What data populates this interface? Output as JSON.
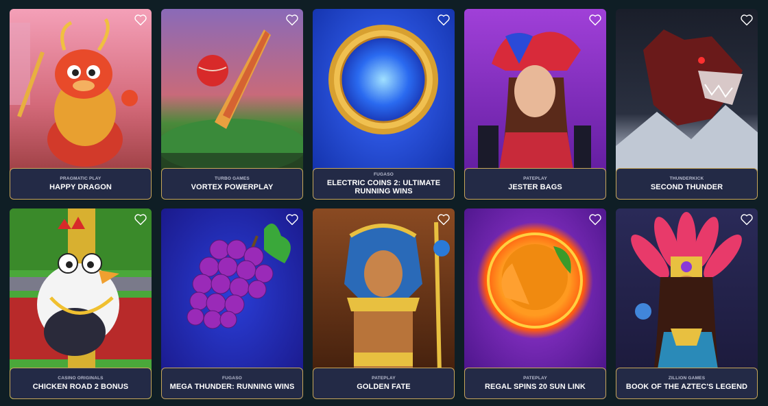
{
  "games": [
    {
      "provider": "PRAGMATIC PLAY",
      "title": "HAPPY DRAGON",
      "theme": "dragon",
      "bg_top": "#e37f96",
      "bg_bottom": "#c25a4f"
    },
    {
      "provider": "TURBO GAMES",
      "title": "VORTEX POWERPLAY",
      "theme": "cricket",
      "bg_top": "#6a5aa8",
      "bg_bottom": "#2b6a3a"
    },
    {
      "provider": "FUGASO",
      "title": "ELECTRIC COINS 2: ULTIMATE RUNNING WINS",
      "theme": "coin",
      "bg_top": "#1a3fd6",
      "bg_bottom": "#1536b8"
    },
    {
      "provider": "PATEPLAY",
      "title": "JESTER BAGS",
      "theme": "jester",
      "bg_top": "#9a3bd0",
      "bg_bottom": "#6a20a8"
    },
    {
      "provider": "THUNDERKICK",
      "title": "SECOND THUNDER",
      "theme": "wolf",
      "bg_top": "#1c2230",
      "bg_bottom": "#5a6270"
    },
    {
      "provider": "CASINO ORIGINALS",
      "title": "CHICKEN ROAD 2 BONUS",
      "theme": "chicken",
      "bg_top": "#4aa83a",
      "bg_bottom": "#b52a2a"
    },
    {
      "provider": "FUGASO",
      "title": "MEGA THUNDER: RUNNING WINS",
      "theme": "grapes",
      "bg_top": "#1a2fb0",
      "bg_bottom": "#2a1a8c"
    },
    {
      "provider": "PATEPLAY",
      "title": "GOLDEN FATE",
      "theme": "pharaoh",
      "bg_top": "#6e3a1a",
      "bg_bottom": "#3a1e10"
    },
    {
      "provider": "PATEPLAY",
      "title": "REGAL SPINS 20 SUN LINK",
      "theme": "orange",
      "bg_top": "#7a28b8",
      "bg_bottom": "#5a1a98"
    },
    {
      "provider": "ZILLION GAMES",
      "title": "BOOK OF THE AZTEC'S LEGEND",
      "theme": "aztec",
      "bg_top": "#2a2a5a",
      "bg_bottom": "#1a1a3a"
    }
  ],
  "colors": {
    "page_bg": "#0f1e25",
    "label_bg": "#232a46",
    "label_border": "#c9a85a",
    "heart": "#ffffff"
  },
  "icons": {
    "favorite": "heart-outline-icon"
  }
}
